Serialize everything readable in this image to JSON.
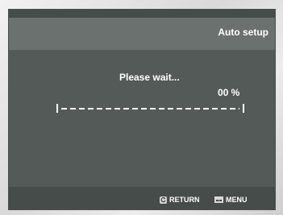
{
  "header": {
    "title": "Auto setup"
  },
  "main": {
    "message": "Please wait...",
    "progress_text": "00 %",
    "progress_value": 0
  },
  "footer": {
    "return_label": "RETURN",
    "menu_label": "MENU",
    "return_icon": "return-arrow-icon",
    "menu_icon": "menu-icon"
  },
  "colors": {
    "screen_bg": "#535a57",
    "title_bar_bg": "#6b716e",
    "bottom_bar_bg": "#464c49",
    "text": "#ffffff"
  }
}
